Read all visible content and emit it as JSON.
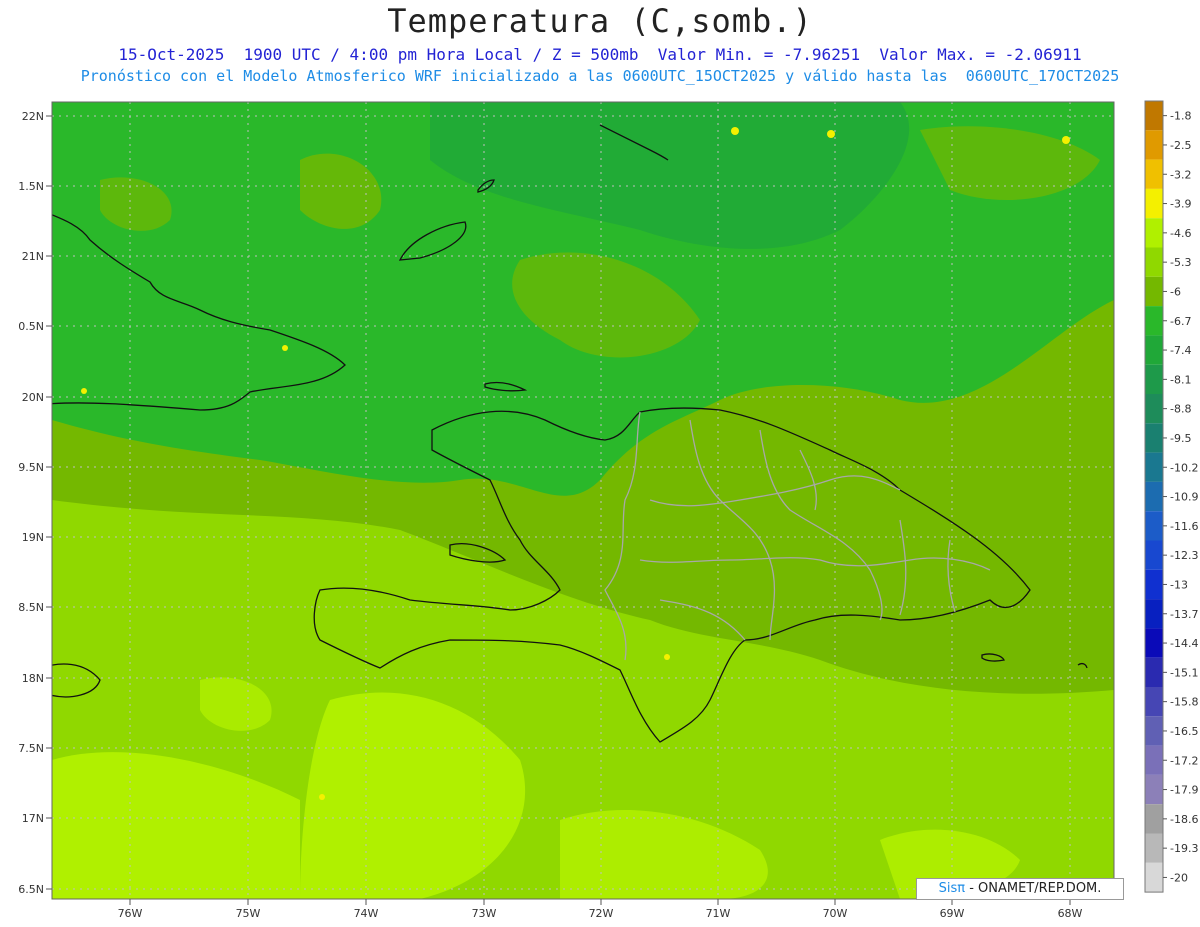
{
  "header": {
    "title": "Temperatura (C,somb.)",
    "subtitle1": "15-Oct-2025  1900 UTC / 4:00 pm Hora Local / Z = 500mb  Valor Min. = -7.96251  Valor Max. = -2.06911",
    "subtitle2": "Pronóstico con el Modelo Atmosferico WRF inicializado a las 0600UTC_15OCT2025 y válido hasta las  0600UTC_17OCT2025"
  },
  "map": {
    "lat_labels": [
      "22N",
      "1.5N",
      "21N",
      "0.5N",
      "20N",
      "9.5N",
      "19N",
      "8.5N",
      "18N",
      "7.5N",
      "17N",
      "6.5N"
    ],
    "lon_labels": [
      "76W",
      "75W",
      "74W",
      "73W",
      "72W",
      "71W",
      "70W",
      "69W",
      "68W"
    ]
  },
  "colorbar": {
    "levels": [
      "-1.8",
      "-2.5",
      "-3.2",
      "-3.9",
      "-4.6",
      "-5.3",
      "-6",
      "-6.7",
      "-7.4",
      "-8.1",
      "-8.8",
      "-9.5",
      "-10.2",
      "-10.9",
      "-11.6",
      "-12.3",
      "-13",
      "-13.7",
      "-14.4",
      "-15.1",
      "-15.8",
      "-16.5",
      "-17.2",
      "-17.9",
      "-18.6",
      "-19.3",
      "-20"
    ],
    "colors": [
      "#c07800",
      "#e09a00",
      "#f0c000",
      "#f4f000",
      "#b0f000",
      "#90d800",
      "#74b800",
      "#2ab82a",
      "#20a838",
      "#1e9a4a",
      "#1e8c5a",
      "#1a8070",
      "#1a7890",
      "#1c6cb0",
      "#1c5cc8",
      "#1848d0",
      "#1030d0",
      "#0820c0",
      "#0a0ab8",
      "#2a2ab0",
      "#4646b4",
      "#6060b4",
      "#7a70b8",
      "#8c80b8",
      "#a0a0a0",
      "#b8b8b8",
      "#d8d8d8"
    ]
  },
  "credit": {
    "sis": "Sisπ",
    "rest": "- ONAMET/REP.DOM."
  },
  "colors": {
    "field_dark_green": "#2ab82a",
    "field_mid_green": "#74b800",
    "field_light_green": "#90d800",
    "field_yellow_green": "#b0f000"
  }
}
